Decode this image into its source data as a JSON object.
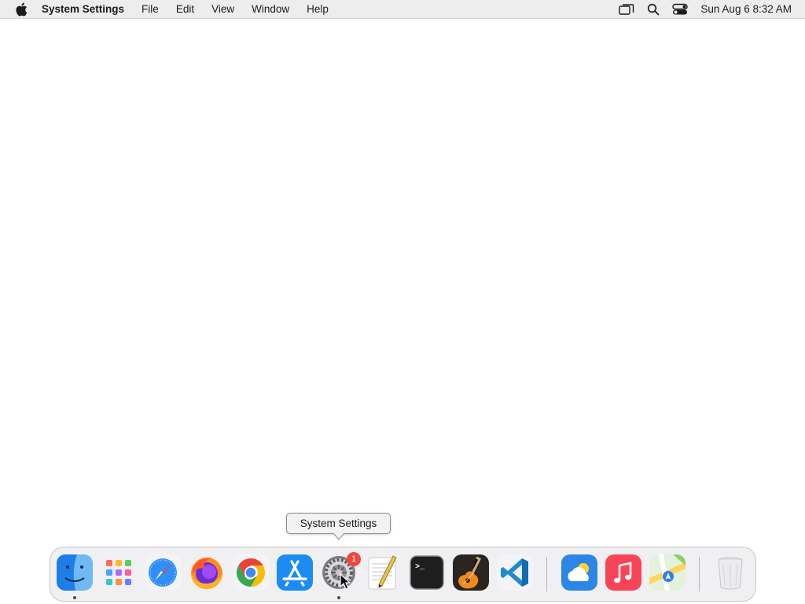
{
  "menubar": {
    "app_name": "System Settings",
    "items": [
      "File",
      "Edit",
      "View",
      "Window",
      "Help"
    ],
    "icons": [
      "apple-logo-icon",
      "screen-mirroring-icon",
      "spotlight-search-icon",
      "control-center-icon"
    ],
    "clock": "Sun Aug 6  8:32 AM"
  },
  "tooltip": {
    "text": "System Settings"
  },
  "dock": {
    "apps": [
      {
        "name": "Finder",
        "icon": "finder-icon",
        "running": true
      },
      {
        "name": "Launchpad",
        "icon": "launchpad-icon",
        "running": false
      },
      {
        "name": "Safari",
        "icon": "safari-icon",
        "running": false
      },
      {
        "name": "Firefox",
        "icon": "firefox-icon",
        "running": false
      },
      {
        "name": "Google Chrome",
        "icon": "chrome-icon",
        "running": false
      },
      {
        "name": "App Store",
        "icon": "app-store-icon",
        "running": false
      },
      {
        "name": "System Settings",
        "icon": "system-settings-icon",
        "running": true,
        "badge": "1"
      },
      {
        "name": "TextEdit",
        "icon": "textedit-icon",
        "running": false
      },
      {
        "name": "Terminal",
        "icon": "terminal-icon",
        "running": false
      },
      {
        "name": "GarageBand",
        "icon": "garageband-icon",
        "running": false
      },
      {
        "name": "Visual Studio Code",
        "icon": "vscode-icon",
        "running": false
      },
      {
        "name": "Weather",
        "icon": "weather-icon",
        "running": false
      },
      {
        "name": "Music",
        "icon": "music-icon",
        "running": false
      },
      {
        "name": "Maps",
        "icon": "maps-icon",
        "running": false
      },
      {
        "name": "Trash",
        "icon": "trash-icon",
        "running": false
      }
    ],
    "badge_count": "1",
    "terminal_prompt": ">_"
  },
  "colors": {
    "menubar_bg": "#ededed",
    "badge": "#f3473a",
    "dock_bg": "#eeeef0"
  }
}
